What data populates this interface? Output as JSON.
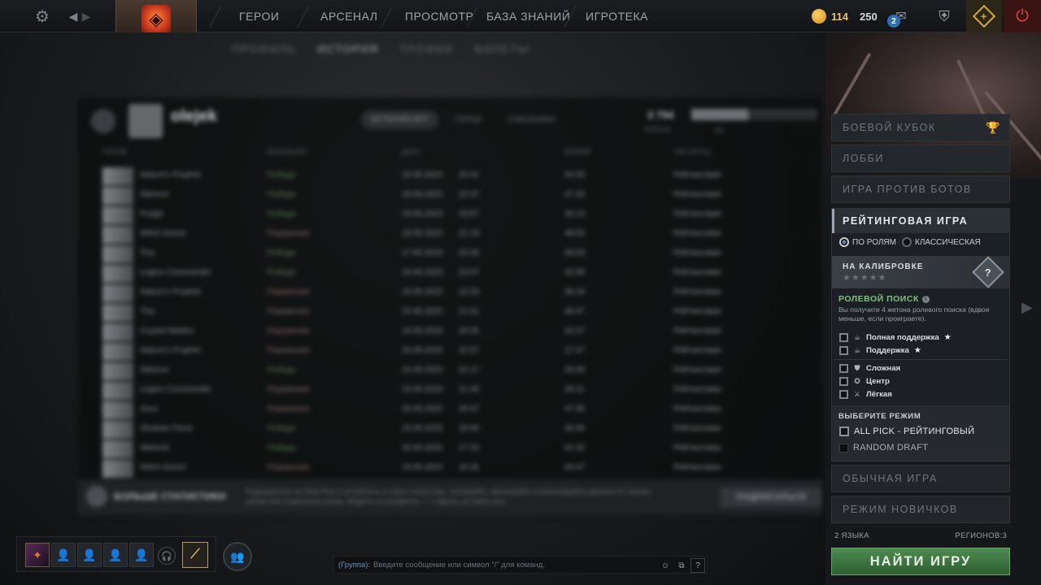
{
  "topbar": {
    "nav": [
      "ГЕРОИ",
      "АРСЕНАЛ",
      "ПРОСМОТР",
      "БАЗА ЗНАНИЙ",
      "ИГРОТЕКА"
    ],
    "currency_gold": "114",
    "currency_shards": "250",
    "mail_count": "2"
  },
  "subnav": [
    "ПРОФИЛЬ",
    "ИСТОРИЯ",
    "ТРОФЕИ",
    "БИЛЕТЫ"
  ],
  "profile": {
    "name": "olejek",
    "tabs": [
      "ИСТОРИЯ ИГР",
      "ГЕРОИ",
      "СОЮЗНИКИ"
    ],
    "mmr": "3 794",
    "mmr_label": "Рейтинг",
    "progress_pct": "0%",
    "progress_fraction": 0.45
  },
  "columns": [
    "ГЕРОЙ",
    "РЕЗУЛЬТАТ",
    "ДАТА",
    "ВРЕМЯ",
    "ТИП ИГРЫ"
  ],
  "matches": [
    {
      "hero": "Nature's Prophet",
      "result": "Победа",
      "win": true,
      "date": "19.05.2023",
      "time": "20:41",
      "dur": "44:20",
      "type": "Рейтинговая"
    },
    {
      "hero": "Silencer",
      "result": "Победа",
      "win": true,
      "date": "19.05.2023",
      "time": "22:47",
      "dur": "47:33",
      "type": "Рейтинговая"
    },
    {
      "hero": "Pudge",
      "result": "Победа",
      "win": true,
      "date": "19.05.2023",
      "time": "23:57",
      "dur": "34:13",
      "type": "Рейтинговая"
    },
    {
      "hero": "Witch Doctor",
      "result": "Поражение",
      "win": false,
      "date": "18.05.2023",
      "time": "21:19",
      "dur": "48:53",
      "type": "Рейтинговая"
    },
    {
      "hero": "Tiny",
      "result": "Победа",
      "win": true,
      "date": "17.05.2023",
      "time": "20:26",
      "dur": "39:03",
      "type": "Рейтинговая"
    },
    {
      "hero": "Legion Commander",
      "result": "Победа",
      "win": true,
      "date": "16.05.2023",
      "time": "23:07",
      "dur": "42:09",
      "type": "Рейтинговая"
    },
    {
      "hero": "Nature's Prophet",
      "result": "Поражение",
      "win": false,
      "date": "16.05.2023",
      "time": "22:33",
      "dur": "38:18",
      "type": "Рейтинговая"
    },
    {
      "hero": "Tiny",
      "result": "Поражение",
      "win": false,
      "date": "16.05.2023",
      "time": "21:01",
      "dur": "36:47",
      "type": "Рейтинговая"
    },
    {
      "hero": "Crystal Maiden",
      "result": "Поражение",
      "win": false,
      "date": "16.05.2023",
      "time": "20:26",
      "dur": "42:37",
      "type": "Рейтинговая"
    },
    {
      "hero": "Nature's Prophet",
      "result": "Поражение",
      "win": false,
      "date": "15.05.2023",
      "time": "22:57",
      "dur": "17:47",
      "type": "Рейтинговая"
    },
    {
      "hero": "Silencer",
      "result": "Победа",
      "win": true,
      "date": "15.05.2023",
      "time": "22:17",
      "dur": "33:49",
      "type": "Рейтинговая"
    },
    {
      "hero": "Legion Commander",
      "result": "Поражение",
      "win": false,
      "date": "15.05.2023",
      "time": "21:46",
      "dur": "28:11",
      "type": "Рейтинговая"
    },
    {
      "hero": "Zeus",
      "result": "Поражение",
      "win": false,
      "date": "15.05.2023",
      "time": "20:47",
      "dur": "47:35",
      "type": "Рейтинговая"
    },
    {
      "hero": "Shadow Fiend",
      "result": "Победа",
      "win": true,
      "date": "15.05.2023",
      "time": "18:40",
      "dur": "26:45",
      "type": "Рейтинговая"
    },
    {
      "hero": "Warlock",
      "result": "Победа",
      "win": true,
      "date": "15.05.2023",
      "time": "17:23",
      "dur": "41:32",
      "type": "Рейтинговая"
    },
    {
      "hero": "Witch Doctor",
      "result": "Поражение",
      "win": false,
      "date": "15.05.2023",
      "time": "16:26",
      "dur": "43:47",
      "type": "Рейтинговая"
    }
  ],
  "morestats": {
    "title": "БОЛЬШЕ СТАТИСТИКИ",
    "text": "Подпишитесь на Dota Plus и углубитесь в свою статистику: сортируйте, фильтруйте и анализируйте данные по героям, ролям или отдельным играм. Модели на профилях — с фразы не найти все.",
    "button": "ПОДПИСАТЬСЯ"
  },
  "right": {
    "battle_cup": "БОЕВОЙ КУБОК",
    "lobby": "ЛОББИ",
    "bots": "ИГРА ПРОТИВ БОТОВ",
    "ranked": "РЕЙТИНГОВАЯ ИГРА",
    "radio_roles": "ПО РОЛЯМ",
    "radio_classic": "КЛАССИЧЕСКАЯ",
    "calibration": "НА КАЛИБРОВКЕ",
    "calibration_stars": "★★★★★",
    "calibration_badge": "?",
    "role_search": "РОЛЕВОЙ ПОИСК",
    "role_search_desc": "Вы получите 4 жетона ролевого поиска (вдвое меньше, если проиграете).",
    "roles": [
      {
        "label": "Полная поддержка",
        "icon": "☕",
        "star": "★"
      },
      {
        "label": "Поддержка",
        "icon": "☕",
        "star": "★"
      },
      {
        "label": "Сложная",
        "icon": "⛊",
        "star": ""
      },
      {
        "label": "Центр",
        "icon": "✪",
        "star": ""
      },
      {
        "label": "Лёгкая",
        "icon": "⚔",
        "star": ""
      }
    ],
    "select_mode": "ВЫБЕРИТЕ РЕЖИМ",
    "mode_all_pick": "ALL PICK - РЕЙТИНГОВЫЙ",
    "mode_random_draft": "RANDOM DRAFT",
    "normal": "ОБЫЧНАЯ ИГРА",
    "newbie": "РЕЖИМ НОВИЧКОВ",
    "languages": "2 ЯЗЫКА",
    "regions": "РЕГИОНОВ:3",
    "find_game": "НАЙТИ ИГРУ"
  },
  "chat": {
    "channel": "(Группа):",
    "placeholder": "Введите сообщение или символ \"/\" для команд.",
    "help": "?"
  },
  "party": {
    "rank_glyph": "⟋"
  }
}
